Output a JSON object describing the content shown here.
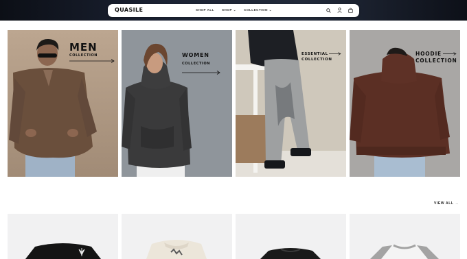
{
  "header": {
    "logo": "QUASILE",
    "nav": [
      {
        "label": "SHOP ALL",
        "has_dropdown": false
      },
      {
        "label": "SHOP",
        "has_dropdown": true
      },
      {
        "label": "COLLECTION",
        "has_dropdown": true
      }
    ],
    "icons": [
      "search-icon",
      "account-icon",
      "cart-icon"
    ]
  },
  "collections": [
    {
      "title": "MEN",
      "subtitle": "COLLECTION",
      "bg": "#b59e8a"
    },
    {
      "title": "WOMEN",
      "subtitle": "COLLECTION",
      "bg": "#8f959b"
    },
    {
      "title": "ESSENTIAL",
      "subtitle": "COLLECTION",
      "bg": "#c8c1b4"
    },
    {
      "title": "HOODIE",
      "subtitle": "COLLECTION",
      "bg": "#a7a5a3"
    }
  ],
  "products": {
    "view_all_label": "VIEW ALL →",
    "items": [
      {
        "name": "black-graphic-tee"
      },
      {
        "name": "cream-graphic-tee"
      },
      {
        "name": "black-patterned-tee"
      },
      {
        "name": "grey-white-raglan-tee"
      }
    ]
  },
  "colors": {
    "topbar": "#1b2233",
    "product_bg": "#f1f1f2"
  }
}
